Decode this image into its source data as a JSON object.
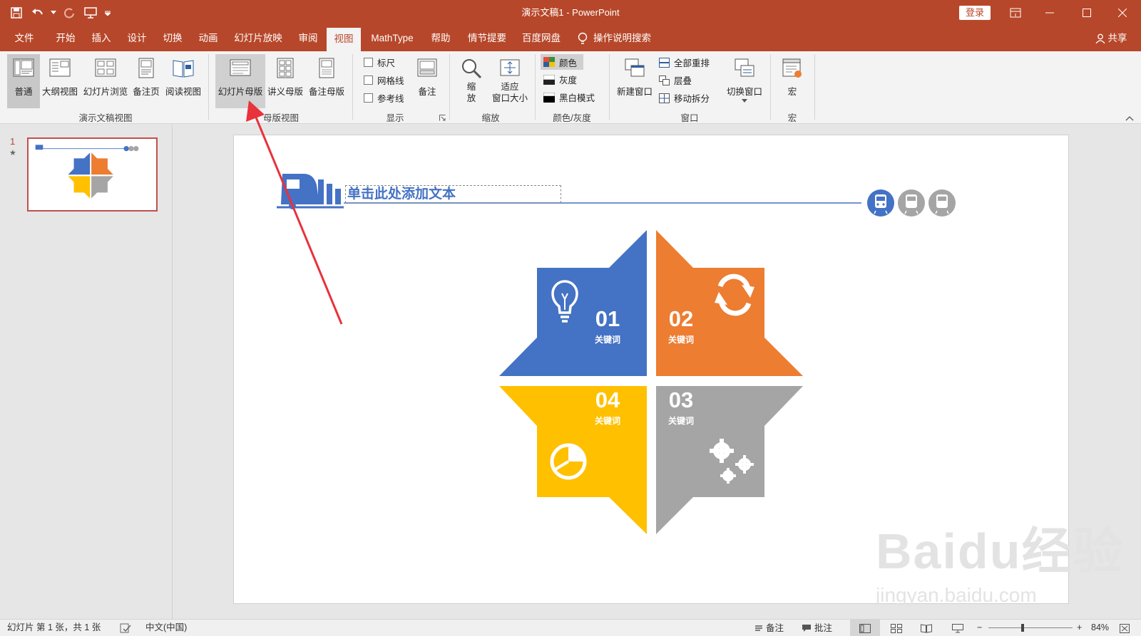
{
  "window": {
    "title": "演示文稿1  -  PowerPoint",
    "login": "登录",
    "share": "共享"
  },
  "tabs": [
    {
      "label": "文件"
    },
    {
      "label": "开始"
    },
    {
      "label": "插入"
    },
    {
      "label": "设计"
    },
    {
      "label": "切换"
    },
    {
      "label": "动画"
    },
    {
      "label": "幻灯片放映"
    },
    {
      "label": "审阅"
    },
    {
      "label": "视图"
    },
    {
      "label": "MathType"
    },
    {
      "label": "帮助"
    },
    {
      "label": "情节提要"
    },
    {
      "label": "百度网盘"
    }
  ],
  "tell_me": "操作说明搜索",
  "ribbon": {
    "presentation_views": {
      "label": "演示文稿视图",
      "buttons": [
        "普通",
        "大纲视图",
        "幻灯片浏览",
        "备注页",
        "阅读视图"
      ]
    },
    "master_views": {
      "label": "母版视图",
      "buttons": [
        "幻灯片母版",
        "讲义母版",
        "备注母版"
      ]
    },
    "show": {
      "label": "显示",
      "checks": [
        "标尺",
        "网格线",
        "参考线"
      ],
      "notes": "备注"
    },
    "zoom": {
      "label": "缩放",
      "zoom_line1": "缩",
      "zoom_line2": "放",
      "fit_line1": "适应",
      "fit_line2": "窗口大小"
    },
    "color": {
      "label": "颜色/灰度",
      "options": [
        "颜色",
        "灰度",
        "黑白模式"
      ]
    },
    "window": {
      "label": "窗口",
      "new_window": "新建窗口",
      "options": [
        "全部重排",
        "层叠",
        "移动拆分"
      ],
      "switch": "切换窗口"
    },
    "macro": {
      "label": "宏",
      "button": "宏"
    }
  },
  "thumbnail": {
    "number": "1",
    "star": "★"
  },
  "slide": {
    "title_placeholder": "单击此处添加文本",
    "quadrants": [
      {
        "num": "01",
        "keyword": "关键词",
        "color": "#4472c4",
        "icon": "lightbulb-icon"
      },
      {
        "num": "02",
        "keyword": "关键词",
        "color": "#ed7d31",
        "icon": "refresh-icon"
      },
      {
        "num": "03",
        "keyword": "关键词",
        "color": "#a5a5a5",
        "icon": "gears-icon"
      },
      {
        "num": "04",
        "keyword": "关键词",
        "color": "#ffc000",
        "icon": "pie-chart-icon"
      }
    ]
  },
  "statusbar": {
    "slide_info": "幻灯片 第 1 张，共 1 张",
    "language": "中文(中国)",
    "notes": "备注",
    "comments": "批注",
    "zoom": "84%"
  },
  "watermark": {
    "line1": "Baidu经验",
    "line2": "jingyan.baidu.com"
  },
  "colors": {
    "accent": "#b7472a",
    "arrow": "#e8323c"
  }
}
